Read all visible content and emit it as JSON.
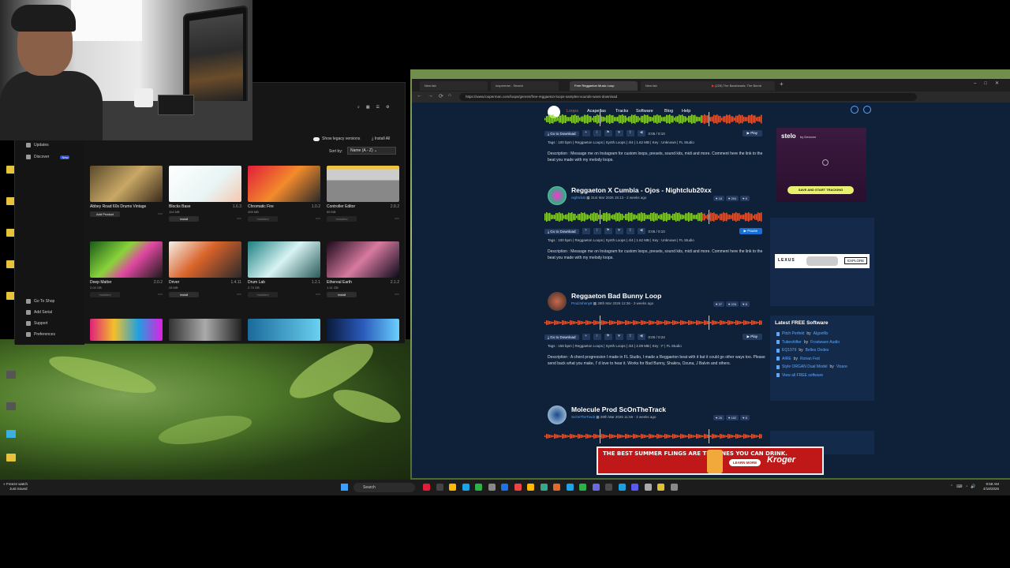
{
  "plugin_manager": {
    "sidebar": {
      "top_items": [
        "Updates",
        "Discover"
      ],
      "new_badge": "New",
      "bottom_items": [
        "Go To Shop",
        "Add Serial",
        "Support",
        "Preferences"
      ]
    },
    "show_legacy_label": "Show legacy versions",
    "install_all_label": "Install All",
    "sort_label": "Sort by:",
    "sort_value": "Name (A - Z)",
    "plugins": [
      {
        "name": "Abbey Road 60s Drums Vintage",
        "version": "",
        "size": "",
        "action": "Add Product",
        "dim": false
      },
      {
        "name": "Blocks Base",
        "version": "1.6.3",
        "size": "114 MB",
        "action": "Install",
        "dim": false
      },
      {
        "name": "Chromatic Fire",
        "version": "1.0.2",
        "size": "498 MB",
        "action": "Installed",
        "dim": true
      },
      {
        "name": "Controller Editor",
        "version": "2.8.2",
        "size": "59 MB",
        "action": "Installed",
        "dim": true
      },
      {
        "name": "Deep Matter",
        "version": "2.0.2",
        "size": "2.04 GB",
        "action": "Installed",
        "dim": true
      },
      {
        "name": "Driver",
        "version": "1.4.11",
        "size": "28 MB",
        "action": "Install",
        "dim": false
      },
      {
        "name": "Drum Lab",
        "version": "1.2.1",
        "size": "2.73 GB",
        "action": "Installed",
        "dim": true
      },
      {
        "name": "Ethereal Earth",
        "version": "2.1.2",
        "size": "1.41 GB",
        "action": "Install",
        "dim": false
      }
    ]
  },
  "browser": {
    "tabs": [
      "New tab",
      "looperman - Search",
      "Free Reggaeton Music Loop",
      "New tab",
      "(225) The Backheads: The Bumb"
    ],
    "url": "https://www.looperman.com/loops/genres/free-reggaeton-loops-samples-sounds-wavs-download"
  },
  "looperman": {
    "nav": [
      "Loops",
      "Acapellas",
      "Tracks",
      "Software",
      "Blog",
      "Help"
    ],
    "goto_label": "Go to Download",
    "loops": [
      {
        "title": "",
        "author": "",
        "date": "",
        "time_display": "0:05 / 0:10",
        "play_label": "Play",
        "tags": "Tags : 100 bpm | Reggaeton Loops | Synth Loops | 4/4 | 1.62 MB | Key : Unknown | FL Studio",
        "description": "Description : Message me on Instagram for custom loops, presets, sound kits, midi and more. Comment here the link to the beat you made with my melody loops.",
        "stats": []
      },
      {
        "title": "Reggaeton X Cumbia - Ojos - Nightclub20xx",
        "author": "nightclub",
        "date": "31st Mar 2026 15:13 - 2 weeks ago",
        "time_display": "0:05 / 0:10",
        "play_label": "Pause",
        "tags": "Tags : 100 bpm | Reggaeton Loops | Synth Loops | 4/4 | 1.62 MB | Key : Unknown | FL Studio",
        "description": "Description : Message me on Instagram for custom loops, presets, sound kits, midi and more. Comment here the link to the beat you made with my melody loops.",
        "stats": [
          "18",
          "284",
          "8"
        ]
      },
      {
        "title": "Reggaeton Bad Bunny Loop",
        "author": "ProdJohnny8",
        "date": "28th Mar 2026 12:36 - 3 weeks ago",
        "time_display": "0:00 / 0:24",
        "play_label": "Play",
        "tags": "Tags : 158 bpm | Reggaeton Loops | Synth Loops | 4/4 | 4.09 MB | Key : F | FL Studio",
        "description": "Description : A chord progression I made in FL Studio, I made a Reggaeton beat with it but it could go other ways too. Please send back what you make, I' d love to hear it. Works for Bad Bunny, Shakira, Ozuna, J Balvin and others.",
        "stats": [
          "37",
          "226",
          "8"
        ]
      },
      {
        "title": "Molecule Prod ScOnTheTrack",
        "author": "ScOnTheTrack",
        "date": "28th Mar 2026 11:56 - 3 weeks ago",
        "time_display": "",
        "play_label": "",
        "tags": "",
        "description": "",
        "stats": [
          "26",
          "182",
          "8"
        ]
      }
    ],
    "ads": {
      "stelo_brand": "stelo",
      "stelo_sub": "by Dexcom",
      "stelo_cta": "SAVE AND START TRACKING",
      "lexus_brand": "LEXUS",
      "lexus_cta": "EXPLORE",
      "kroger_text": "THE BEST SUMMER FLINGS ARE THE ONES YOU CAN DRINK.",
      "kroger_cta": "LEARN MORE",
      "kroger_brand": "Kroger"
    },
    "free_software": {
      "title": "Latest FREE Software",
      "items": [
        {
          "name": "Pitch Perfekt",
          "by": "by",
          "author": "Algonfilx"
        },
        {
          "name": "Tubeshifter",
          "by": "by",
          "author": "Frostwave Audio"
        },
        {
          "name": "EQ1979",
          "by": "by",
          "author": "Belles Ondes"
        },
        {
          "name": "AIRE",
          "by": "by",
          "author": "Ronan Fed"
        },
        {
          "name": "Style ORGAN Dual Model",
          "by": "by",
          "author": "Visare"
        },
        {
          "name": "View all FREE software",
          "by": "",
          "author": ""
        }
      ]
    }
  },
  "taskbar": {
    "search_placeholder": "Search",
    "notification_title": "Freeze watch",
    "notification_sub": "Just issued",
    "clock_time": "9:58 AM",
    "clock_date": "4/18/2026"
  },
  "colors": {
    "looperman_bg": "#0f2039",
    "accent_orange": "#e25b3a",
    "accent_green": "#8fd43b",
    "link_blue": "#5aa8ff"
  }
}
